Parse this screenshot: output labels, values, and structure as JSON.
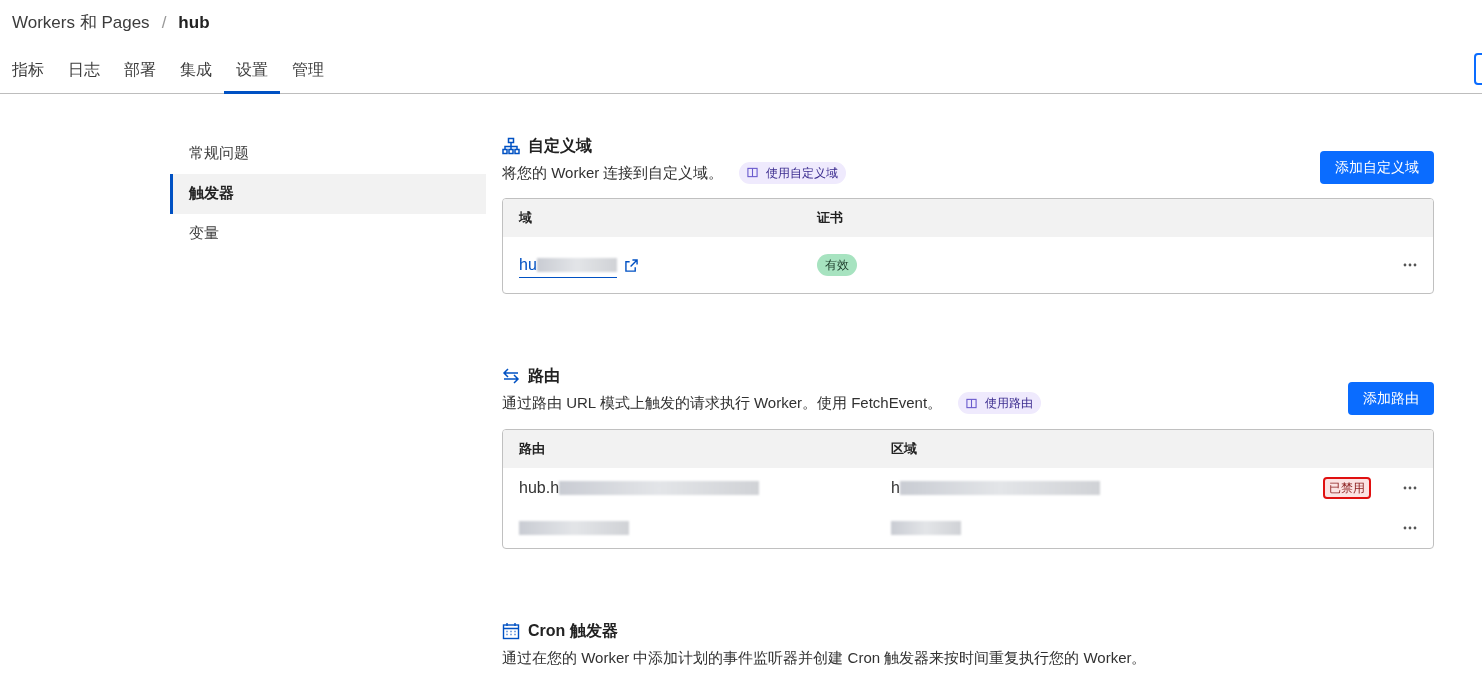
{
  "breadcrumb": {
    "parent": "Workers 和 Pages",
    "separator": "/",
    "current": "hub"
  },
  "tabs": [
    {
      "label": "指标",
      "selected": false
    },
    {
      "label": "日志",
      "selected": false
    },
    {
      "label": "部署",
      "selected": false
    },
    {
      "label": "集成",
      "selected": false
    },
    {
      "label": "设置",
      "selected": true
    },
    {
      "label": "管理",
      "selected": false
    }
  ],
  "sidebar": {
    "items": [
      {
        "label": "常规问题",
        "selected": false
      },
      {
        "label": "触发器",
        "selected": true
      },
      {
        "label": "变量",
        "selected": false
      }
    ]
  },
  "sections": [
    {
      "kind": "domains",
      "title": "自定义域",
      "description": "将您的 Worker 连接到自定义域。",
      "doc_link": "使用自定义域",
      "action": "添加自定义域",
      "table": {
        "columns": [
          "域",
          "证书"
        ],
        "rows": [
          {
            "cells": [
              {
                "kind": "link",
                "text": "hu",
                "redacted": true
              },
              {
                "kind": "badge",
                "text": "有效",
                "color": "#a7e3c0"
              }
            ]
          }
        ]
      }
    },
    {
      "kind": "routes",
      "title": "路由",
      "description": "通过路由 URL 模式上触发的请求执行 Worker。使用 FetchEvent。",
      "doc_link": "使用路由",
      "action": "添加路由",
      "table": {
        "columns": [
          "路由",
          "区域"
        ],
        "rows": [
          {
            "cells": [
              {
                "kind": "text",
                "text": "hub.h",
                "redacted": true
              },
              {
                "kind": "text",
                "text": "h",
                "redacted": true
              }
            ],
            "status": {
              "text": "已禁用",
              "highlighted": true
            }
          },
          {
            "cells": [
              {
                "kind": "text",
                "redacted": true
              },
              {
                "kind": "text",
                "redacted": true
              }
            ]
          }
        ]
      }
    },
    {
      "kind": "cron",
      "title": "Cron 触发器",
      "description": "通过在您的 Worker 中添加计划的事件监听器并创建 Cron 触发器来按时间重复执行您的 Worker。"
    }
  ]
}
